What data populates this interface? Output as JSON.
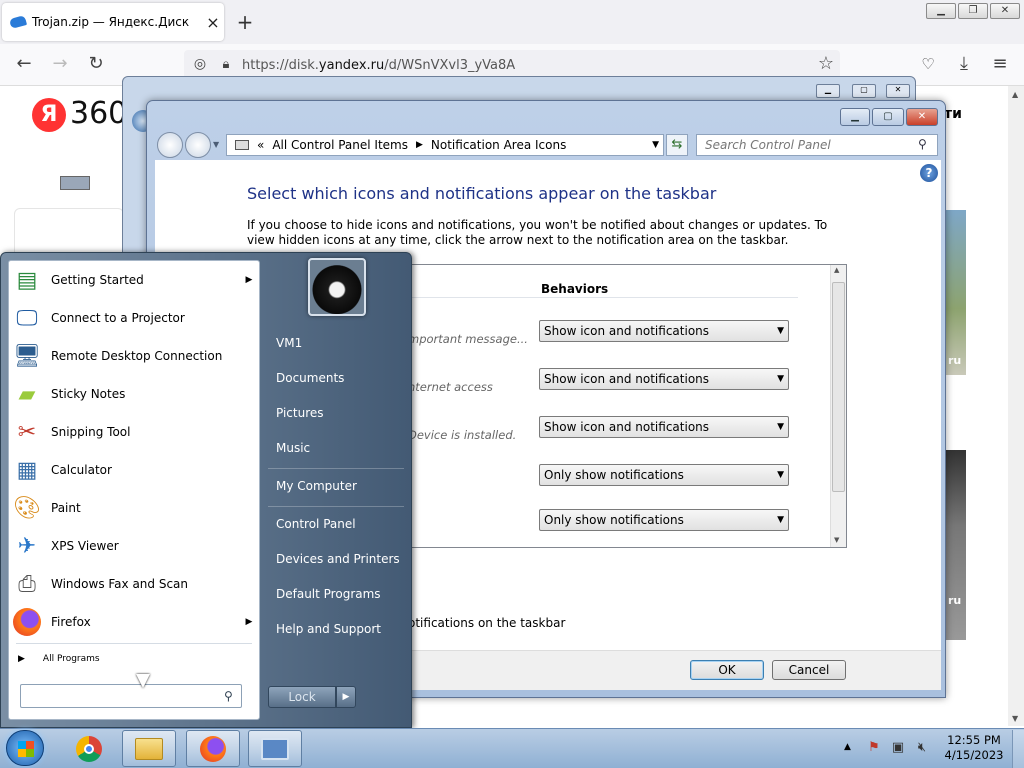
{
  "browser": {
    "tab_title": "Trojan.zip — Яндекс.Диск",
    "url_prefix": "https://disk.",
    "url_host": "yandex.ru",
    "url_path": "/d/WSnVXvl3_yVa8A"
  },
  "page": {
    "logo_letter": "Я",
    "logo_number": "360",
    "button_fragment": "ти",
    "image_label_1": "ru",
    "image_label_2": "ru"
  },
  "control_panel": {
    "breadcrumb": [
      "All Control Panel Items",
      "Notification Area Icons"
    ],
    "search_placeholder": "Search Control Panel",
    "heading": "Select which icons and notifications appear on the taskbar",
    "description": "If you choose to hide icons and notifications, you won't be notified about changes or updates. To view hidden icons at any time, click the arrow next to the notification area on the taskbar.",
    "column_header": "Behaviors",
    "rows": [
      {
        "desc": "mportant message...",
        "behavior": "Show icon and notifications"
      },
      {
        "desc": "nternet access",
        "behavior": "Show icon and notifications"
      },
      {
        "desc": "Device is installed.",
        "behavior": "Show icon and notifications"
      },
      {
        "desc": "",
        "behavior": "Only show notifications"
      },
      {
        "desc": "",
        "behavior": "Only show notifications"
      }
    ],
    "always_show_fragment": "otifications on the taskbar",
    "ok_label": "OK",
    "cancel_label": "Cancel"
  },
  "start_menu": {
    "programs": [
      {
        "label": "Getting Started",
        "icon": "getting-started-icon",
        "submenu": true
      },
      {
        "label": "Connect to a Projector",
        "icon": "projector-icon",
        "submenu": false
      },
      {
        "label": "Remote Desktop Connection",
        "icon": "remote-desktop-icon",
        "submenu": false
      },
      {
        "label": "Sticky Notes",
        "icon": "sticky-notes-icon",
        "submenu": false
      },
      {
        "label": "Snipping Tool",
        "icon": "snipping-tool-icon",
        "submenu": false
      },
      {
        "label": "Calculator",
        "icon": "calculator-icon",
        "submenu": false
      },
      {
        "label": "Paint",
        "icon": "paint-icon",
        "submenu": false
      },
      {
        "label": "XPS Viewer",
        "icon": "xps-viewer-icon",
        "submenu": false
      },
      {
        "label": "Windows Fax and Scan",
        "icon": "fax-scan-icon",
        "submenu": false
      },
      {
        "label": "Firefox",
        "icon": "firefox-icon",
        "submenu": true
      }
    ],
    "all_programs": "All Programs",
    "right_links": [
      "VM1",
      "Documents",
      "Pictures",
      "Music",
      "My Computer",
      "Control Panel",
      "Devices and Printers",
      "Default Programs",
      "Help and Support"
    ],
    "lock_label": "Lock"
  },
  "taskbar": {
    "time": "12:55 PM",
    "date": "4/15/2023"
  }
}
